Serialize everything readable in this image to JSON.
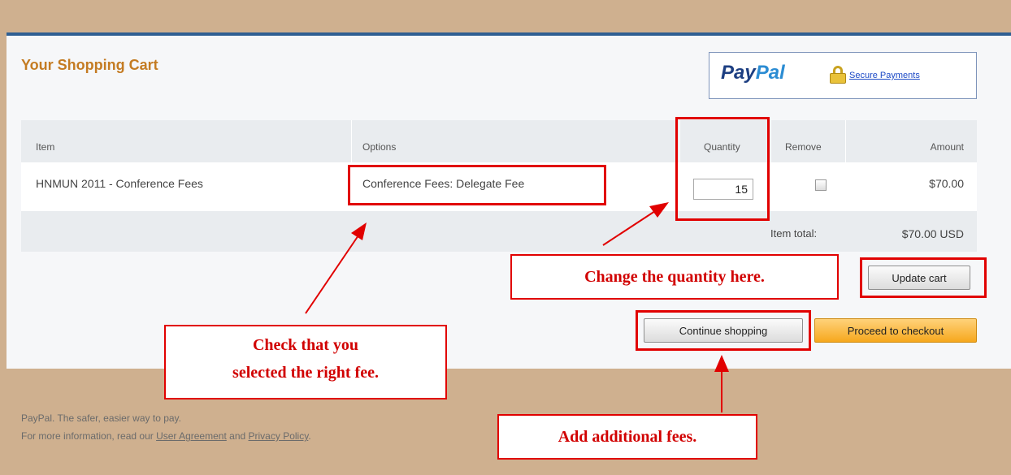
{
  "header": {
    "title": "Your Shopping Cart",
    "paypal_logo_part1": "Pay",
    "paypal_logo_part2": "Pal",
    "secure_link": "Secure Payments"
  },
  "table": {
    "columns": {
      "item": "Item",
      "options": "Options",
      "quantity": "Quantity",
      "remove": "Remove",
      "amount": "Amount"
    },
    "rows": [
      {
        "item": "HNMUN 2011 - Conference Fees",
        "options": "Conference Fees: Delegate Fee",
        "quantity": "15",
        "amount": "$70.00"
      }
    ],
    "total_label": "Item total:",
    "total_value": "$70.00 USD"
  },
  "buttons": {
    "update": "Update cart",
    "continue": "Continue shopping",
    "checkout": "Proceed to checkout"
  },
  "annotations": {
    "quantity": "Change the quantity here.",
    "fee_line1": "Check that you",
    "fee_line2": "selected the right fee.",
    "additional": "Add additional fees."
  },
  "footer": {
    "line1": "PayPal. The safer, easier way to pay.",
    "line2_prefix": "For more information, read our",
    "user_agreement": "User Agreement",
    "and": "and",
    "privacy_policy": "Privacy Policy",
    "period": "."
  },
  "colors": {
    "annotation_red": "#e10000",
    "page_brown": "#cfb08f",
    "title_orange": "#c47b22",
    "checkout_orange": "#f6a81e",
    "paypal_blue": "#1d3f82"
  }
}
